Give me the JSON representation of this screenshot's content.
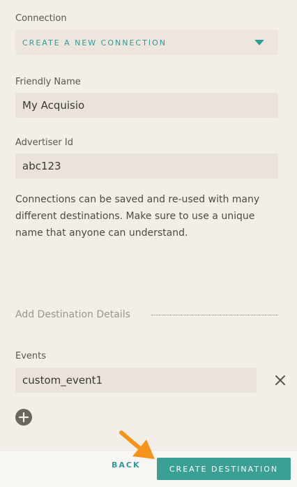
{
  "connection": {
    "label": "Connection",
    "selected": "CREATE A NEW CONNECTION"
  },
  "friendly_name": {
    "label": "Friendly Name",
    "value": "My Acquisio"
  },
  "advertiser_id": {
    "label": "Advertiser Id",
    "value": "abc123"
  },
  "help_text": "Connections can be saved and re-used with many different destinations. Make sure to use a unique name that anyone can understand.",
  "destination_section": {
    "title": "Add Destination Details"
  },
  "events": {
    "label": "Events",
    "items": [
      "custom_event1"
    ]
  },
  "footer": {
    "back_label": "BACK",
    "create_label": "CREATE DESTINATION"
  },
  "icons": {
    "dropdown": "chevron-down-icon",
    "remove": "close-icon",
    "add": "plus-circle-icon",
    "pointer": "arrow-icon"
  },
  "colors": {
    "accent": "#2f9a96",
    "primary_button": "#3aa094",
    "arrow": "#f4931e"
  }
}
